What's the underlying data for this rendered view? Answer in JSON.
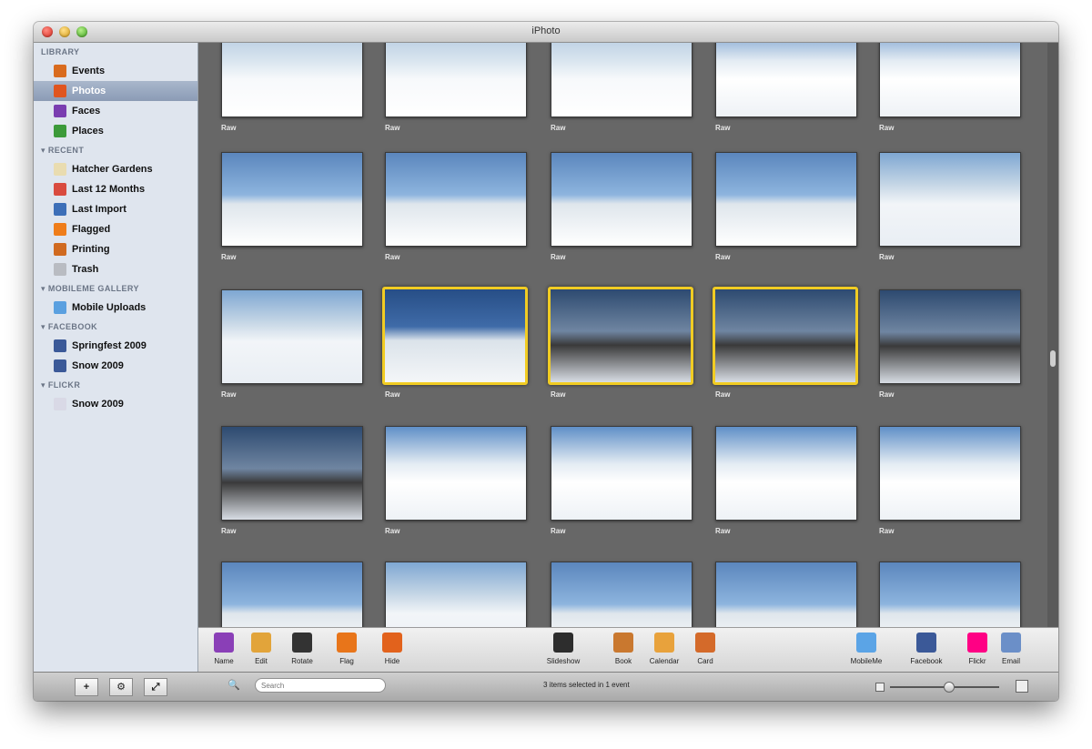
{
  "window": {
    "title": "iPhoto"
  },
  "sidebar": {
    "sections": [
      {
        "header": "LIBRARY",
        "items": [
          {
            "label": "Events",
            "icon": "events-icon",
            "color": "#d96b1e"
          },
          {
            "label": "Photos",
            "icon": "photos-icon",
            "color": "#e0551f",
            "selected": true
          },
          {
            "label": "Faces",
            "icon": "faces-icon",
            "color": "#7a3db0"
          },
          {
            "label": "Places",
            "icon": "places-icon",
            "color": "#3c9a3a"
          }
        ]
      },
      {
        "header": "RECENT",
        "items": [
          {
            "label": "Hatcher Gardens",
            "icon": "album-icon",
            "color": "#e9dcb0"
          },
          {
            "label": "Last 12 Months",
            "icon": "calendar-icon",
            "color": "#d94b3f"
          },
          {
            "label": "Last Import",
            "icon": "import-icon",
            "color": "#3d6fb8"
          },
          {
            "label": "Flagged",
            "icon": "flag-icon",
            "color": "#ef7d1a"
          },
          {
            "label": "Printing",
            "icon": "print-icon",
            "color": "#d06a20"
          },
          {
            "label": "Trash",
            "icon": "trash-icon",
            "color": "#b9bcc2"
          }
        ]
      },
      {
        "header": "MOBILEME GALLERY",
        "items": [
          {
            "label": "Mobile Uploads",
            "icon": "cloud-icon",
            "color": "#5aa0e0"
          }
        ]
      },
      {
        "header": "FACEBOOK",
        "items": [
          {
            "label": "Springfest 2009",
            "icon": "facebook-icon",
            "color": "#3b5998"
          },
          {
            "label": "Snow 2009",
            "icon": "facebook-icon",
            "color": "#3b5998"
          }
        ]
      },
      {
        "header": "FLICKR",
        "items": [
          {
            "label": "Snow 2009",
            "icon": "flickr-icon",
            "color": "#d9d9e6"
          }
        ]
      }
    ]
  },
  "photos": {
    "label": "Raw",
    "rows": [
      [
        "s1",
        "s1",
        "s1",
        "s6",
        "s6"
      ],
      [
        "s2",
        "s2",
        "s2",
        "s2",
        "s3"
      ],
      [
        "s3",
        "s4",
        "s5",
        "s5",
        "s5"
      ],
      [
        "s5",
        "s6",
        "s6",
        "s6",
        "s6"
      ],
      [
        "s2",
        "s3",
        "s2",
        "s2",
        "s2"
      ]
    ],
    "selected": [
      [
        2,
        1
      ],
      [
        2,
        2
      ],
      [
        2,
        3
      ]
    ]
  },
  "toolbar": {
    "left": [
      {
        "label": "Name",
        "icon": "name-icon",
        "color": "#8a3fb7"
      },
      {
        "label": "Edit",
        "icon": "pencil-icon",
        "color": "#e2a43a"
      },
      {
        "label": "Rotate",
        "icon": "rotate-icon",
        "color": "#333333"
      },
      {
        "label": "Flag",
        "icon": "flag-icon",
        "color": "#e8751a"
      },
      {
        "label": "Hide",
        "icon": "hide-icon",
        "color": "#e2621c"
      }
    ],
    "center": [
      {
        "label": "Slideshow",
        "icon": "play-icon",
        "color": "#2d2d2d"
      },
      {
        "label": "Book",
        "icon": "book-icon",
        "color": "#c9782f"
      },
      {
        "label": "Calendar",
        "icon": "calendar-icon",
        "color": "#e8a23c"
      },
      {
        "label": "Card",
        "icon": "card-icon",
        "color": "#d46a2a"
      }
    ],
    "right": [
      {
        "label": "MobileMe",
        "icon": "mobileme-icon",
        "color": "#5ba4e6"
      },
      {
        "label": "Facebook",
        "icon": "facebook-icon",
        "color": "#3b5998"
      },
      {
        "label": "Flickr",
        "icon": "flickr-icon",
        "color": "#ff0084"
      },
      {
        "label": "Email",
        "icon": "email-icon",
        "color": "#6b8fc8"
      }
    ]
  },
  "bottombar": {
    "buttons": [
      "+",
      "⚙",
      "⤢"
    ],
    "search_placeholder": "Search",
    "status": "3 items selected in 1 event"
  }
}
